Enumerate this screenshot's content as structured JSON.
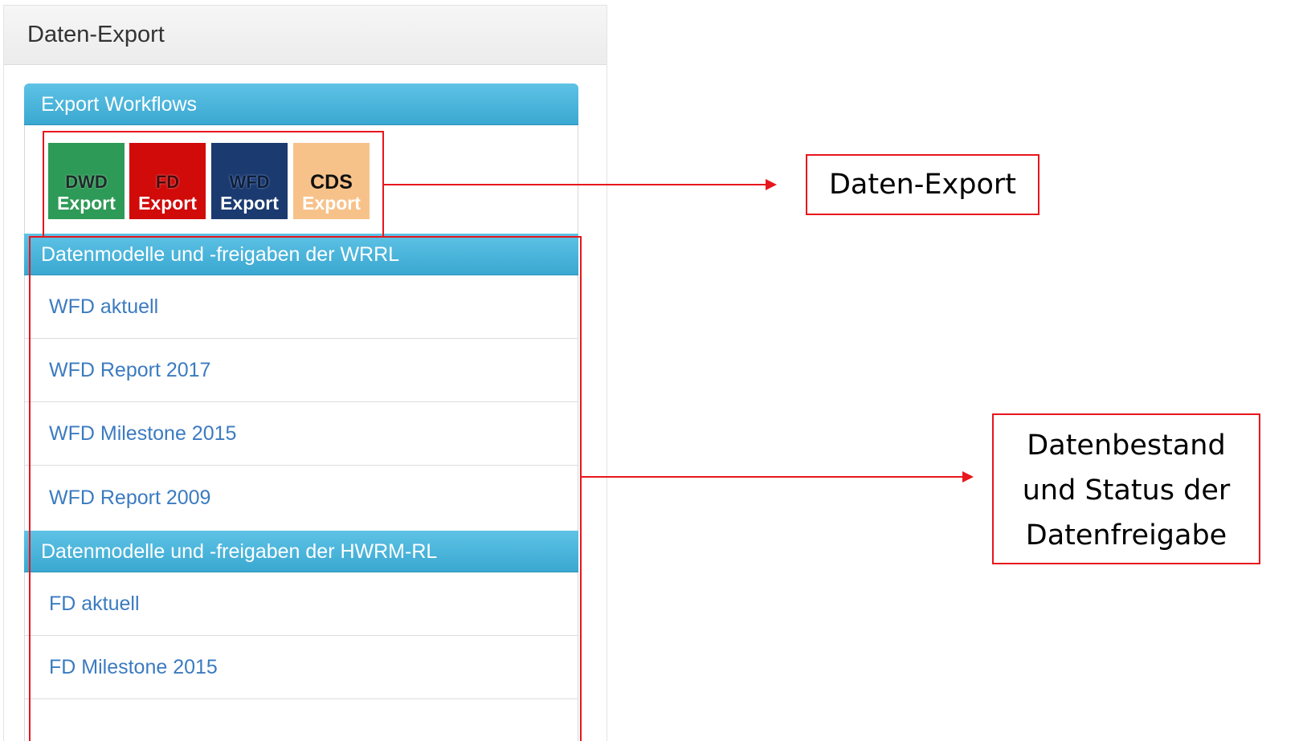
{
  "panel": {
    "title": "Daten-Export"
  },
  "export_workflows": {
    "header": "Export Workflows",
    "tiles": [
      {
        "line1": "DWD",
        "line2": "Export"
      },
      {
        "line1": "FD",
        "line2": "Export"
      },
      {
        "line1": "WFD",
        "line2": "Export"
      },
      {
        "line1": "CDS",
        "line2": "Export"
      }
    ]
  },
  "wrrl_section": {
    "header": "Datenmodelle und -freigaben der WRRL",
    "items": [
      "WFD aktuell",
      "WFD Report 2017",
      "WFD Milestone 2015",
      "WFD Report 2009"
    ]
  },
  "hwrm_section": {
    "header": "Datenmodelle und -freigaben der HWRM-RL",
    "items": [
      "FD aktuell",
      "FD Milestone 2015"
    ]
  },
  "annotations": {
    "callout_export": "Daten-Export",
    "callout_status_lines": [
      "Datenbestand",
      "und Status der",
      "Datenfreigabe"
    ]
  },
  "colors": {
    "accent_blue": "#3aa8d1",
    "link_blue": "#3b7bc0",
    "annotation_red": "#e8161d",
    "dwd_green": "#2e9a57",
    "fd_red": "#d10a0a",
    "wfd_navy": "#1b3a70",
    "cds_orange": "#f7c28a"
  }
}
